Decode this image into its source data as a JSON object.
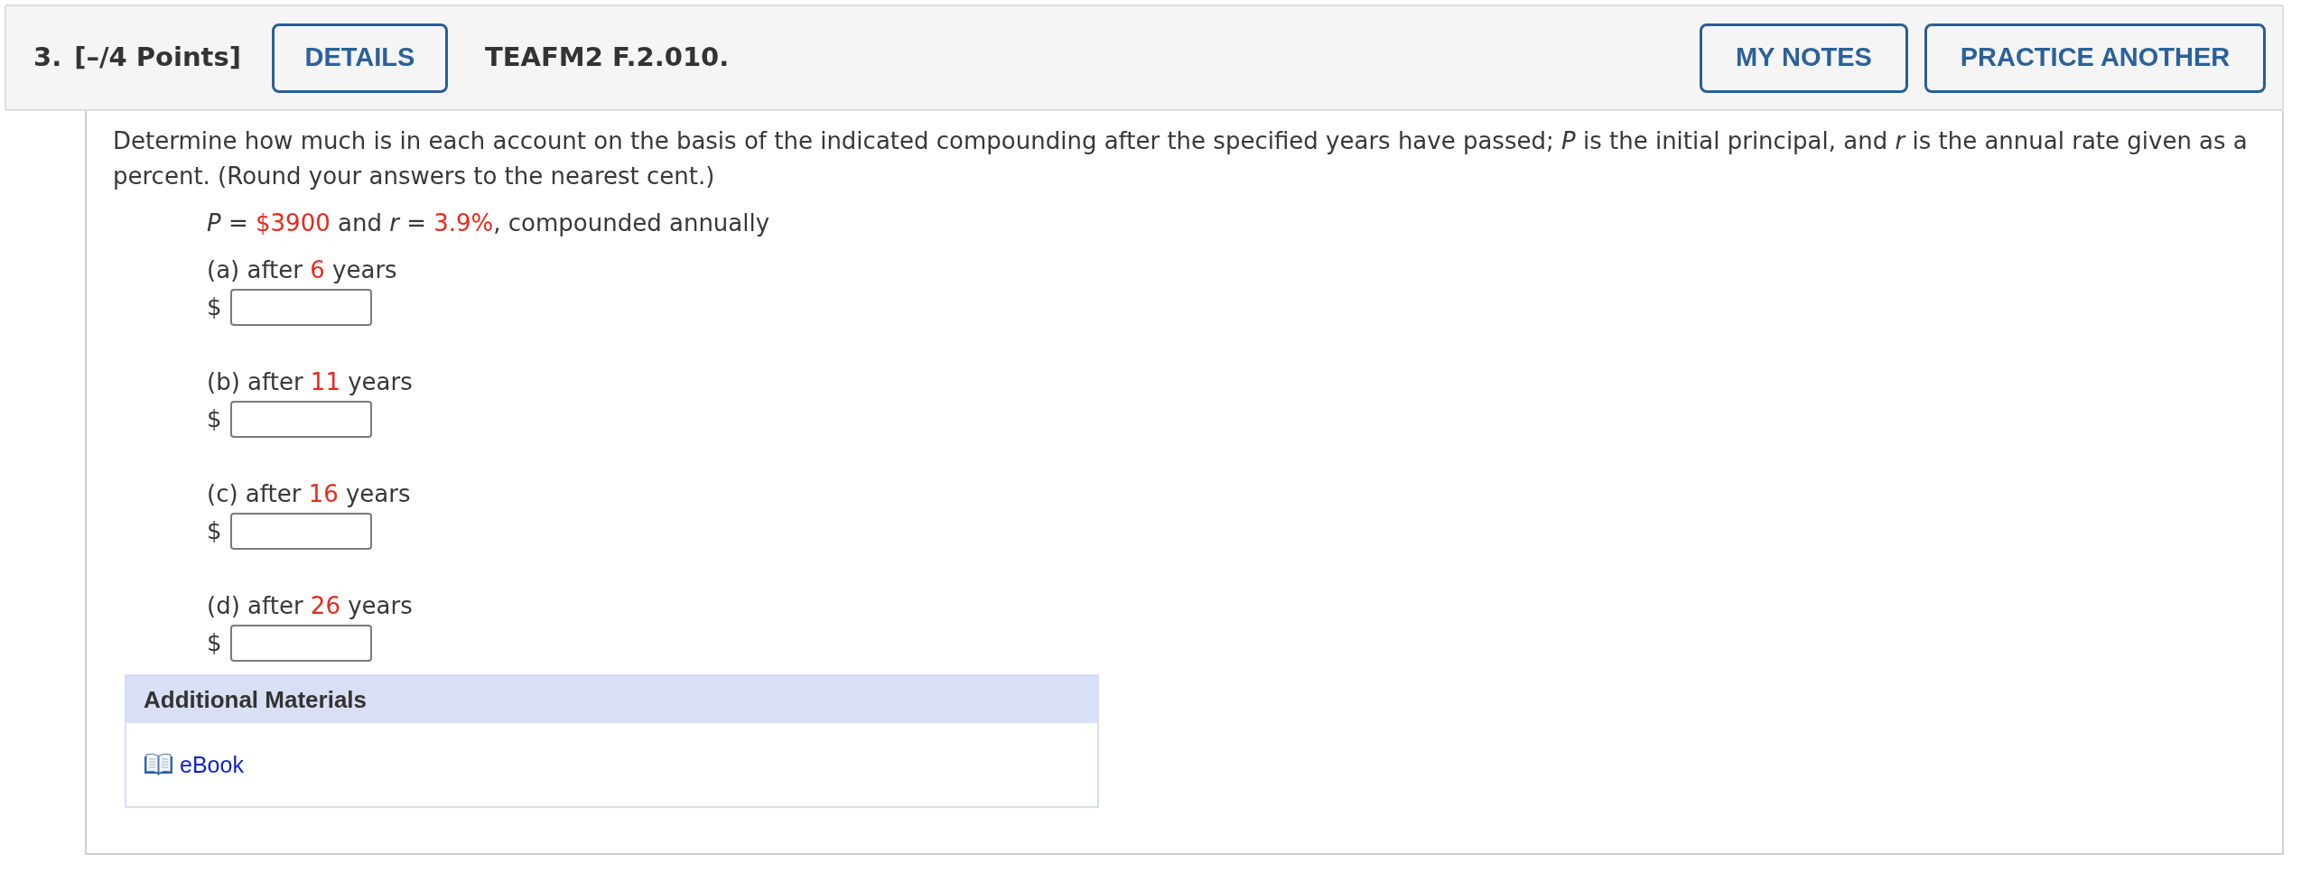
{
  "header": {
    "number": "3.",
    "points": "[–/4 Points]",
    "details_button": "DETAILS",
    "code": "TEAFM2 F.2.010.",
    "actions": [
      "MY NOTES",
      "PRACTICE ANOTHER"
    ]
  },
  "prompt": "Determine how much is in each account on the basis of the indicated compounding after the specified years have passed; *P* is the initial principal, and *r* is the annual rate given as a percent. (Round your answers to the nearest cent.)",
  "given": [
    {
      "kind": "var",
      "text": "P"
    },
    {
      "kind": "text",
      "text": " = "
    },
    {
      "kind": "value",
      "text": "$3900"
    },
    {
      "kind": "text",
      "text": " and "
    },
    {
      "kind": "var",
      "text": "r"
    },
    {
      "kind": "text",
      "text": " = "
    },
    {
      "kind": "value",
      "text": "3.9%"
    },
    {
      "kind": "text",
      "text": ", compounded annually"
    }
  ],
  "parts": [
    {
      "label": "(a) after",
      "value": "6",
      "unit": "years",
      "currency": "$"
    },
    {
      "label": "(b) after",
      "value": "11",
      "unit": "years",
      "currency": "$"
    },
    {
      "label": "(c) after",
      "value": "16",
      "unit": "years",
      "currency": "$"
    },
    {
      "label": "(d) after",
      "value": "26",
      "unit": "years",
      "currency": "$"
    }
  ],
  "additional_materials": {
    "title": "Additional Materials",
    "links": [
      {
        "label": "eBook"
      }
    ]
  }
}
